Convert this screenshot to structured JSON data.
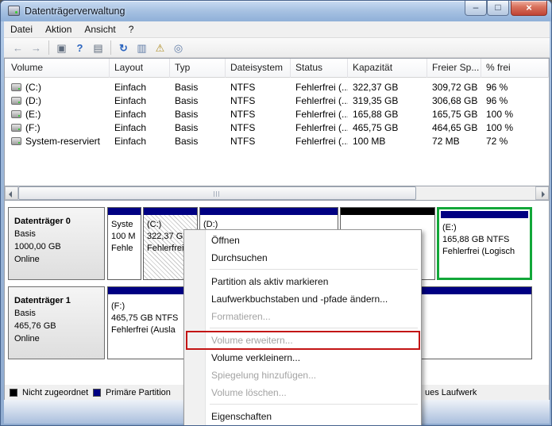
{
  "window": {
    "title": "Datenträgerverwaltung",
    "controls": {
      "minimize": "–",
      "maximize": "□",
      "close": "×"
    }
  },
  "menubar": {
    "items": [
      "Datei",
      "Aktion",
      "Ansicht",
      "?"
    ]
  },
  "toolbar": {
    "buttons": [
      {
        "name": "back",
        "glyph": "←"
      },
      {
        "name": "forward",
        "glyph": "→"
      },
      {
        "name": "console-tree",
        "glyph": "▣"
      },
      {
        "name": "help",
        "glyph": "?"
      },
      {
        "name": "export-list",
        "glyph": "▤"
      },
      {
        "name": "refresh",
        "glyph": "↻"
      },
      {
        "name": "disk-list",
        "glyph": "▥"
      },
      {
        "name": "rescan-disks",
        "glyph": "⚠"
      },
      {
        "name": "search",
        "glyph": "◎"
      }
    ]
  },
  "table": {
    "columns": [
      "Volume",
      "Layout",
      "Typ",
      "Dateisystem",
      "Status",
      "Kapazität",
      "Freier Sp...",
      "% frei"
    ],
    "rows": [
      [
        "(C:)",
        "Einfach",
        "Basis",
        "NTFS",
        "Fehlerfrei (...",
        "322,37 GB",
        "309,72 GB",
        "96 %"
      ],
      [
        "(D:)",
        "Einfach",
        "Basis",
        "NTFS",
        "Fehlerfrei (...",
        "319,35 GB",
        "306,68 GB",
        "96 %"
      ],
      [
        "(E:)",
        "Einfach",
        "Basis",
        "NTFS",
        "Fehlerfrei (...",
        "165,88 GB",
        "165,75 GB",
        "100 %"
      ],
      [
        "(F:)",
        "Einfach",
        "Basis",
        "NTFS",
        "Fehlerfrei (...",
        "465,75 GB",
        "464,65 GB",
        "100 %"
      ],
      [
        "System-reserviert",
        "Einfach",
        "Basis",
        "NTFS",
        "Fehlerfrei (...",
        "100 MB",
        "72 MB",
        "72 %"
      ]
    ]
  },
  "graph": {
    "disk0": {
      "name": "Datenträger 0",
      "type": "Basis",
      "capacity": "1000,00 GB",
      "status": "Online",
      "partitions": {
        "system": {
          "line1": "Syste",
          "line2": "100 M",
          "line3": "Fehle"
        },
        "c": {
          "line1": "(C:)",
          "line2": "322,37 GB",
          "line3": "Fehlerfrei"
        },
        "d": {
          "line1": "(D:)"
        },
        "e": {
          "line1": "(E:)",
          "line2": "165,88 GB NTFS",
          "line3": "Fehlerfrei (Logisch"
        }
      }
    },
    "disk1": {
      "name": "Datenträger 1",
      "type": "Basis",
      "capacity": "465,76 GB",
      "status": "Online",
      "partitions": {
        "f": {
          "line1": "(F:)",
          "line2": "465,75 GB NTFS",
          "line3": "Fehlerfrei (Ausla"
        }
      }
    }
  },
  "legend": {
    "unallocated": "Nicht zugeordnet",
    "primary": "Primäre Partition",
    "partial": "ues Laufwerk"
  },
  "colors": {
    "band_primary": "#000082",
    "unallocated": "#000000",
    "extended_green": "#12a739",
    "highlight_red": "#c31414"
  },
  "context_menu": {
    "items": [
      {
        "label": "Öffnen",
        "enabled": true
      },
      {
        "label": "Durchsuchen",
        "enabled": true
      },
      {
        "label": "Partition als aktiv markieren",
        "enabled": true
      },
      {
        "label": "Laufwerkbuchstaben und -pfade ändern...",
        "enabled": true
      },
      {
        "label": "Formatieren...",
        "enabled": false
      },
      {
        "label": "Volume erweitern...",
        "enabled": false,
        "highlighted": true
      },
      {
        "label": "Volume verkleinern...",
        "enabled": true
      },
      {
        "label": "Spiegelung hinzufügen...",
        "enabled": false
      },
      {
        "label": "Volume löschen...",
        "enabled": false
      },
      {
        "label": "Eigenschaften",
        "enabled": true
      }
    ]
  }
}
